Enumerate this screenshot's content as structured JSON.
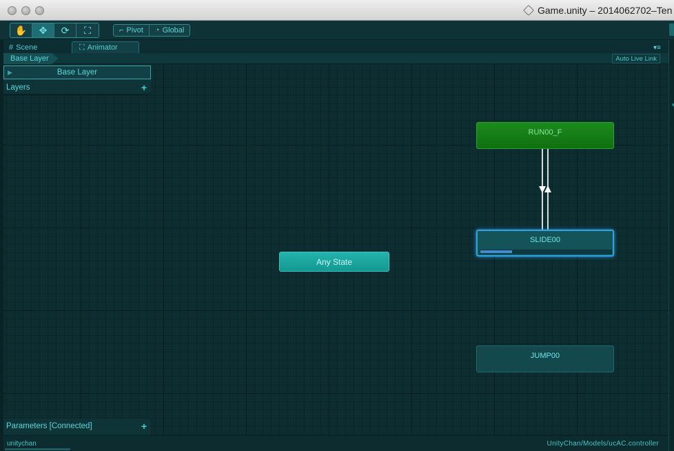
{
  "window": {
    "title": "Game.unity – 2014062702–Ten"
  },
  "toolbar": {
    "tools": [
      {
        "name": "hand-tool",
        "glyph": "✋",
        "active": false
      },
      {
        "name": "move-tool",
        "glyph": "✥",
        "active": true
      },
      {
        "name": "rotate-tool",
        "glyph": "⟳",
        "active": false
      },
      {
        "name": "scale-tool",
        "glyph": "⛶",
        "active": false
      }
    ],
    "pivot_label": "Pivot",
    "global_label": "Global"
  },
  "tabs": {
    "scene": "Scene",
    "animator": "Animator"
  },
  "breadcrumb": {
    "layer": "Base Layer"
  },
  "auto_live_link": "Auto Live Link",
  "layers_panel": {
    "items": [
      {
        "label": "Base Layer"
      }
    ],
    "title": "Layers",
    "add": "+"
  },
  "parameters_panel": {
    "title": "Parameters [Connected]",
    "add": "+"
  },
  "states": {
    "run": {
      "label": "RUN00_F"
    },
    "slide": {
      "label": "SLIDE00",
      "progress": 0.24
    },
    "jump": {
      "label": "JUMP00"
    },
    "any": {
      "label": "Any State"
    }
  },
  "status": {
    "object": "unitychan",
    "controller": "UnityChan/Models/ucAC.controller"
  },
  "colors": {
    "accent": "#3fd3d6",
    "run_state": "#158016",
    "selected_border": "#33a2e0",
    "any_state": "#1ea6a0"
  }
}
